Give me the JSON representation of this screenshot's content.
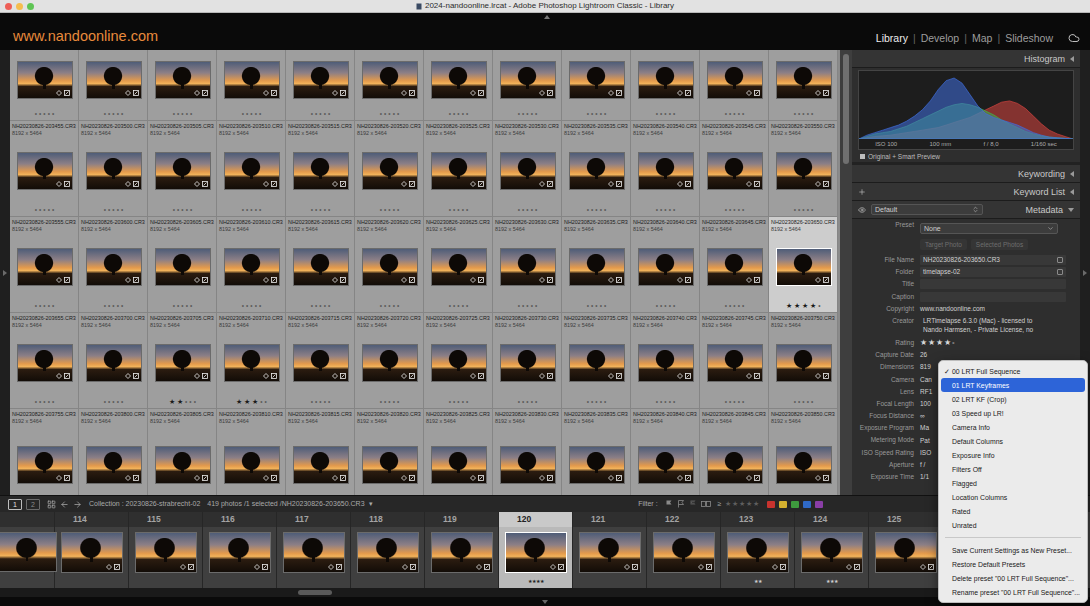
{
  "window": {
    "title": "2024-nandoonline.lrcat - Adobe Photoshop Lightroom Classic - Library"
  },
  "identity_plate": {
    "text": "www.nandoonline.com"
  },
  "modules": {
    "separator": "|",
    "items": [
      {
        "label": "Library",
        "selected": true
      },
      {
        "label": "Develop",
        "selected": false
      },
      {
        "label": "Map",
        "selected": false
      },
      {
        "label": "Slideshow",
        "selected": false
      }
    ]
  },
  "rating_glyphs": {
    "star": "★",
    "dot": "•"
  },
  "grid": {
    "rows": [
      {
        "cells": [
          {
            "stars": 0,
            "selected": false
          },
          {
            "stars": 0,
            "selected": false
          },
          {
            "stars": 0,
            "selected": false
          },
          {
            "stars": 0,
            "selected": false
          },
          {
            "stars": 0,
            "selected": false
          },
          {
            "stars": 0,
            "selected": false
          },
          {
            "stars": 0,
            "selected": false
          },
          {
            "stars": 0,
            "selected": false
          },
          {
            "stars": 0,
            "selected": false
          },
          {
            "stars": 0,
            "selected": false
          },
          {
            "stars": 0,
            "selected": false
          },
          {
            "stars": 0,
            "selected": false
          }
        ]
      },
      {
        "cells": [
          {
            "file": "NH20230826-203455.CR3",
            "dims": "8192 x 5464",
            "stars": 0,
            "selected": false
          },
          {
            "file": "NH20230826-203500.CR3",
            "dims": "8192 x 5464",
            "stars": 0,
            "selected": false
          },
          {
            "file": "NH20230826-203505.CR3",
            "dims": "8192 x 5464",
            "stars": 0,
            "selected": false
          },
          {
            "file": "NH20230826-203510.CR3",
            "dims": "8192 x 5464",
            "stars": 0,
            "selected": false
          },
          {
            "file": "NH20230826-203515.CR3",
            "dims": "8192 x 5464",
            "stars": 0,
            "selected": false
          },
          {
            "file": "NH20230826-203520.CR3",
            "dims": "8192 x 5464",
            "stars": 0,
            "selected": false
          },
          {
            "file": "NH20230826-203525.CR3",
            "dims": "8192 x 5464",
            "stars": 0,
            "selected": false
          },
          {
            "file": "NH20230826-203530.CR3",
            "dims": "8192 x 5464",
            "stars": 0,
            "selected": false
          },
          {
            "file": "NH20230826-203535.CR3",
            "dims": "8192 x 5464",
            "stars": 0,
            "selected": false
          },
          {
            "file": "NH20230826-203540.CR3",
            "dims": "8192 x 5464",
            "stars": 0,
            "selected": false
          },
          {
            "file": "NH20230826-203545.CR3",
            "dims": "8192 x 5464",
            "stars": 0,
            "selected": false
          },
          {
            "file": "NH20230826-203550.CR3",
            "dims": "8192 x 5464",
            "stars": 0,
            "selected": false
          }
        ]
      },
      {
        "cells": [
          {
            "file": "NH20230826-203555.CR3",
            "dims": "8192 x 5464",
            "stars": 0,
            "selected": false
          },
          {
            "file": "NH20230826-203600.CR3",
            "dims": "8192 x 5464",
            "stars": 0,
            "selected": false
          },
          {
            "file": "NH20230826-203605.CR3",
            "dims": "8192 x 5464",
            "stars": 0,
            "selected": false
          },
          {
            "file": "NH20230826-203610.CR3",
            "dims": "8192 x 5464",
            "stars": 0,
            "selected": false
          },
          {
            "file": "NH20230826-203615.CR3",
            "dims": "8192 x 5464",
            "stars": 0,
            "selected": false
          },
          {
            "file": "NH20230826-203620.CR3",
            "dims": "8192 x 5464",
            "stars": 0,
            "selected": false
          },
          {
            "file": "NH20230826-203625.CR3",
            "dims": "8192 x 5464",
            "stars": 0,
            "selected": false
          },
          {
            "file": "NH20230826-203630.CR3",
            "dims": "8192 x 5464",
            "stars": 0,
            "selected": false
          },
          {
            "file": "NH20230826-203635.CR3",
            "dims": "8192 x 5464",
            "stars": 0,
            "selected": false
          },
          {
            "file": "NH20230826-203640.CR3",
            "dims": "8192 x 5464",
            "stars": 0,
            "selected": false
          },
          {
            "file": "NH20230826-203645.CR3",
            "dims": "8192 x 5464",
            "stars": 0,
            "selected": false
          },
          {
            "file": "NH20230826-203650.CR3",
            "dims": "8192 x 5464",
            "stars": 4,
            "selected": true
          }
        ]
      },
      {
        "cells": [
          {
            "file": "NH20230826-203655.CR3",
            "dims": "8192 x 5464",
            "stars": 0,
            "selected": false
          },
          {
            "file": "NH20230826-203700.CR3",
            "dims": "8192 x 5464",
            "stars": 0,
            "selected": false
          },
          {
            "file": "NH20230826-203705.CR3",
            "dims": "8192 x 5464",
            "stars": 2,
            "selected": false
          },
          {
            "file": "NH20230826-203710.CR3",
            "dims": "8192 x 5464",
            "stars": 3,
            "selected": false
          },
          {
            "file": "NH20230826-203715.CR3",
            "dims": "8192 x 5464",
            "stars": 0,
            "selected": false
          },
          {
            "file": "NH20230826-203720.CR3",
            "dims": "8192 x 5464",
            "stars": 0,
            "selected": false
          },
          {
            "file": "NH20230826-203725.CR3",
            "dims": "8192 x 5464",
            "stars": 0,
            "selected": false
          },
          {
            "file": "NH20230826-203730.CR3",
            "dims": "8192 x 5464",
            "stars": 0,
            "selected": false
          },
          {
            "file": "NH20230826-203735.CR3",
            "dims": "8192 x 5464",
            "stars": 0,
            "selected": false
          },
          {
            "file": "NH20230826-203740.CR3",
            "dims": "8192 x 5464",
            "stars": 0,
            "selected": false
          },
          {
            "file": "NH20230826-203745.CR3",
            "dims": "8192 x 5464",
            "stars": 0,
            "selected": false
          },
          {
            "file": "NH20230826-203750.CR3",
            "dims": "8192 x 5464",
            "stars": 0,
            "selected": false
          }
        ]
      },
      {
        "cells": [
          {
            "file": "NH20230826-203755.CR3",
            "dims": "8192 x 5464",
            "selected": false
          },
          {
            "file": "NH20230826-203800.CR3",
            "dims": "8192 x 5464",
            "selected": false
          },
          {
            "file": "NH20230826-203805.CR3",
            "dims": "8192 x 5464",
            "selected": false
          },
          {
            "file": "NH20230826-203810.CR3",
            "dims": "8192 x 5464",
            "selected": false
          },
          {
            "file": "NH20230826-203815.CR3",
            "dims": "8192 x 5464",
            "selected": false
          },
          {
            "file": "NH20230826-203820.CR3",
            "dims": "8192 x 5464",
            "selected": false
          },
          {
            "file": "NH20230826-203825.CR3",
            "dims": "8192 x 5464",
            "selected": false
          },
          {
            "file": "NH20230826-203830.CR3",
            "dims": "8192 x 5464",
            "selected": false
          },
          {
            "file": "NH20230826-203835.CR3",
            "dims": "8192 x 5464",
            "selected": false
          },
          {
            "file": "NH20230826-203840.CR3",
            "dims": "8192 x 5464",
            "selected": false
          },
          {
            "file": "NH20230826-203845.CR3",
            "dims": "8192 x 5464",
            "selected": false
          },
          {
            "file": "NH20230826-203850.CR3",
            "dims": "8192 x 5464",
            "selected": false
          }
        ]
      }
    ]
  },
  "toolbar": {
    "screens": [
      {
        "label": "1",
        "selected": true
      },
      {
        "label": "2",
        "selected": false
      }
    ],
    "collection": "Collection : 20230826-strabrecht-02",
    "count": "419 photos /1 selected /NH20230826-203650.CR3",
    "count_caret": "▾",
    "filter_label": "Filter :",
    "rating_op": "≥",
    "rating_stars": "★★★★★",
    "color_labels": [
      {
        "color": "#c8332e"
      },
      {
        "color": "#d4b02f"
      },
      {
        "color": "#3e9a3e"
      },
      {
        "color": "#2f69c6"
      },
      {
        "color": "#8a3ea6"
      }
    ]
  },
  "filmstrip": {
    "items": [
      {
        "number": "114",
        "stars": 0,
        "selected": false
      },
      {
        "number": "115",
        "stars": 0,
        "selected": false
      },
      {
        "number": "116",
        "stars": 0,
        "selected": false
      },
      {
        "number": "117",
        "stars": 0,
        "selected": false
      },
      {
        "number": "118",
        "stars": 0,
        "selected": false
      },
      {
        "number": "119",
        "stars": 0,
        "selected": false
      },
      {
        "number": "120",
        "stars": 4,
        "selected": true
      },
      {
        "number": "121",
        "stars": 0,
        "selected": false
      },
      {
        "number": "122",
        "stars": 0,
        "selected": false
      },
      {
        "number": "123",
        "stars": 2,
        "selected": false
      },
      {
        "number": "124",
        "stars": 3,
        "selected": false
      },
      {
        "number": "125",
        "stars": 0,
        "selected": false
      }
    ]
  },
  "histogram": {
    "title": "Histogram",
    "series": [
      {
        "name": "red",
        "color": "#d9453f",
        "values": [
          0,
          2,
          4,
          5,
          6,
          8,
          10,
          12,
          14,
          16,
          18,
          22,
          26,
          30,
          34,
          40,
          46,
          52,
          58,
          60,
          56,
          48,
          36,
          24,
          14,
          8,
          4,
          0
        ]
      },
      {
        "name": "green",
        "color": "#3fb04f",
        "values": [
          0,
          4,
          8,
          10,
          12,
          16,
          20,
          26,
          32,
          38,
          44,
          50,
          54,
          56,
          54,
          50,
          44,
          38,
          30,
          24,
          18,
          12,
          8,
          5,
          3,
          2,
          1,
          0
        ]
      },
      {
        "name": "blue",
        "color": "#3f6fe0",
        "values": [
          0,
          6,
          10,
          14,
          18,
          22,
          28,
          36,
          46,
          60,
          78,
          92,
          96,
          88,
          70,
          52,
          40,
          34,
          30,
          26,
          22,
          16,
          10,
          6,
          3,
          2,
          1,
          0
        ]
      }
    ],
    "info": [
      "ISO 100",
      "100 mm",
      "f / 8,0",
      "1/160 sec"
    ],
    "preview": "Original + Smart Preview"
  },
  "keywording": {
    "title": "Keywording"
  },
  "keyword_list": {
    "title": "Keyword List"
  },
  "metadata": {
    "title": "Metadata",
    "preset_set": "Default",
    "preset_label": "Preset",
    "preset_value": "None",
    "targets": [
      {
        "label": "Target Photo",
        "disabled": true
      },
      {
        "label": "Selected Photos",
        "disabled": true
      }
    ],
    "fields": [
      {
        "label": "File Name",
        "value": "NH20230826-203650.CR3",
        "kind": "field-action"
      },
      {
        "label": "Folder",
        "value": "timelapse-02",
        "kind": "field-action"
      },
      {
        "label": "Title",
        "value": "",
        "kind": "field"
      },
      {
        "label": "Caption",
        "value": "",
        "kind": "field"
      },
      {
        "label": "Copyright",
        "value": "www.nandoonline.com",
        "kind": "text"
      },
      {
        "label": "Creator",
        "lines": [
          "LRTimelapse 6.3.0 (Mac) - licensed to",
          "Nando Harmsen,  - Private License, no"
        ],
        "kind": "multiline"
      },
      {
        "label": "Rating",
        "stars": 4,
        "kind": "rating"
      },
      {
        "label": "Capture Date",
        "value": "26",
        "kind": "text"
      },
      {
        "label": "Dimensions",
        "value": "819",
        "kind": "text"
      },
      {
        "label": "Camera",
        "value": "Can",
        "kind": "text"
      },
      {
        "label": "Lens",
        "value": "RF1",
        "kind": "text"
      },
      {
        "label": "Focal Length",
        "value": "100",
        "kind": "text"
      },
      {
        "label": "Focus Distance",
        "value": "∞",
        "kind": "text"
      },
      {
        "label": "Exposure Program",
        "value": "Ma",
        "kind": "text"
      },
      {
        "label": "Metering Mode",
        "value": "Pat",
        "kind": "text"
      },
      {
        "label": "ISO Speed Rating",
        "value": "ISO",
        "kind": "text"
      },
      {
        "label": "Aperture",
        "value": "f /",
        "kind": "text"
      },
      {
        "label": "Exposure Time",
        "value": "1/1",
        "kind": "text"
      }
    ]
  },
  "preset_menu": {
    "check": "✓",
    "items": [
      {
        "label": "00 LRT Full Sequence",
        "checked": true,
        "selected": false
      },
      {
        "label": "01 LRT Keyframes",
        "checked": false,
        "selected": true
      },
      {
        "label": "02 LRT KF (Crop)",
        "checked": false,
        "selected": false
      },
      {
        "label": "03 Speed up LR!",
        "checked": false,
        "selected": false
      },
      {
        "label": "Camera Info",
        "checked": false,
        "selected": false
      },
      {
        "label": "Default Columns",
        "checked": false,
        "selected": false
      },
      {
        "label": "Exposure Info",
        "checked": false,
        "selected": false
      },
      {
        "label": "Filters Off",
        "checked": false,
        "selected": false
      },
      {
        "label": "Flagged",
        "checked": false,
        "selected": false
      },
      {
        "label": "Location Columns",
        "checked": false,
        "selected": false
      },
      {
        "label": "Rated",
        "checked": false,
        "selected": false
      },
      {
        "label": "Unrated",
        "checked": false,
        "selected": false
      }
    ],
    "actions": [
      "Save Current Settings as New Preset...",
      "Restore Default Presets",
      "Delete preset \"00 LRT Full Sequence\"...",
      "Rename preset \"00 LRT Full Sequence\"..."
    ]
  }
}
